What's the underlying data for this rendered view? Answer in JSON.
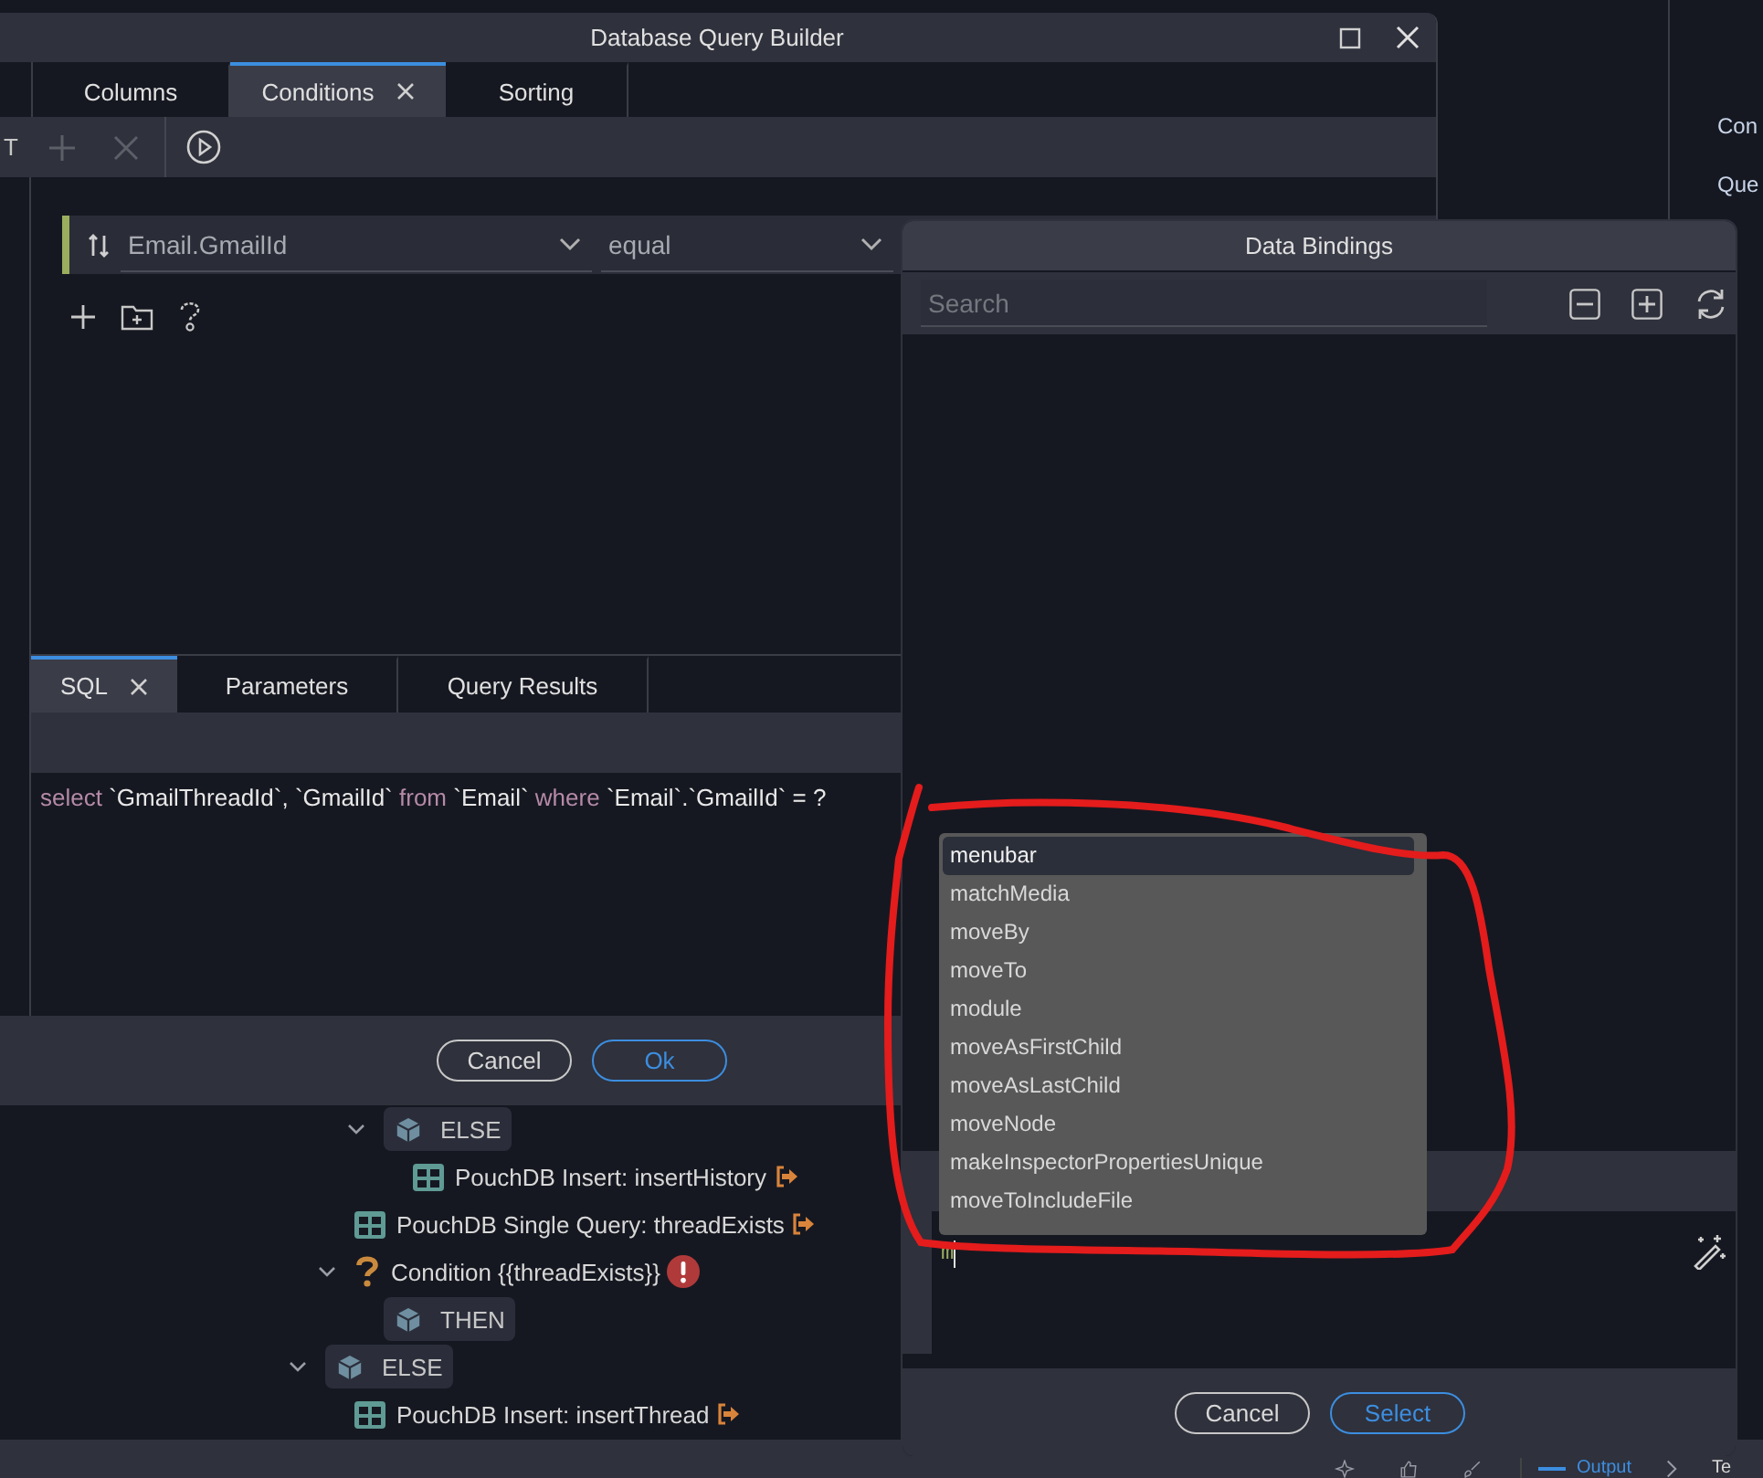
{
  "side_panel": {
    "labels": [
      "Con",
      "Que"
    ]
  },
  "tree": {
    "children": [
      {
        "children": [
          {
            "children": [
              {
                "kind": "branch",
                "label": "ELSE",
                "expanded": true,
                "children": [
                  {
                    "kind": "action",
                    "label": "PouchDB Insert: insertHistory"
                  }
                ]
              }
            ]
          },
          {
            "kind": "action",
            "label": "PouchDB Single Query: threadExists"
          },
          {
            "kind": "condition",
            "label": "Condition {{threadExists}}",
            "error": true,
            "expanded": true,
            "children": [
              {
                "kind": "branch",
                "label": "THEN"
              }
            ]
          }
        ]
      },
      {
        "kind": "branch",
        "label": "ELSE",
        "expanded": true,
        "children": [
          {
            "kind": "action",
            "label": "PouchDB Insert: insertThread"
          }
        ]
      }
    ]
  },
  "status_bar": {
    "output_tab": "Output",
    "next_label": "Te"
  },
  "query_builder": {
    "title": "Database Query Builder",
    "tabs": [
      {
        "label": "Columns",
        "selected": false
      },
      {
        "label": "Conditions",
        "selected": true
      },
      {
        "label": "Sorting",
        "selected": false
      }
    ],
    "toolbar": {
      "cut_label": "T",
      "add_disabled": true,
      "remove_disabled": true
    },
    "condition": {
      "field": "Email.GmailId",
      "operator": "equal"
    },
    "bottom_tabs": [
      {
        "label": "SQL",
        "selected": true
      },
      {
        "label": "Parameters",
        "selected": false
      },
      {
        "label": "Query Results",
        "selected": false
      }
    ],
    "sql": [
      {
        "text": "select",
        "kind": "keyword"
      },
      {
        "text": " `GmailThreadId`, `GmailId` ",
        "kind": "identifier"
      },
      {
        "text": "from",
        "kind": "keyword"
      },
      {
        "text": " `Email` ",
        "kind": "identifier"
      },
      {
        "text": "where",
        "kind": "keyword"
      },
      {
        "text": " `Email`.`GmailId` = ?",
        "kind": "identifier"
      }
    ],
    "buttons": {
      "cancel": "Cancel",
      "ok": "Ok"
    }
  },
  "data_bindings": {
    "title": "Data Bindings",
    "search": {
      "placeholder": "Search"
    },
    "editor": {
      "value": "m"
    },
    "suggestions": [
      {
        "label": "menubar",
        "selected": true
      },
      {
        "label": "matchMedia",
        "selected": false
      },
      {
        "label": "moveBy",
        "selected": false
      },
      {
        "label": "moveTo",
        "selected": false
      },
      {
        "label": "module",
        "selected": false
      },
      {
        "label": "moveAsFirstChild",
        "selected": false
      },
      {
        "label": "moveAsLastChild",
        "selected": false
      },
      {
        "label": "moveNode",
        "selected": false
      },
      {
        "label": "makeInspectorPropertiesUnique",
        "selected": false
      },
      {
        "label": "moveToIncludeFile",
        "selected": false
      }
    ],
    "buttons": {
      "cancel": "Cancel",
      "select": "Select"
    }
  }
}
